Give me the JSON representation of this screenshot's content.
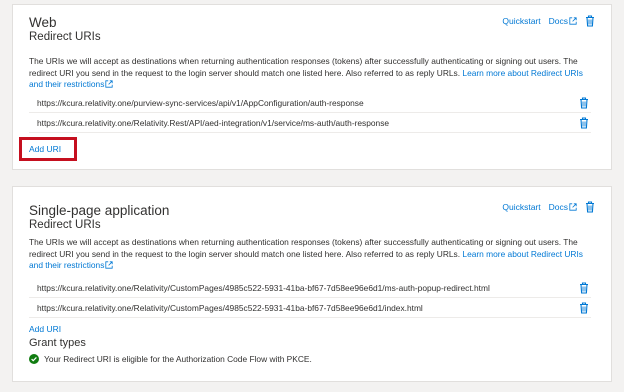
{
  "web": {
    "title": "Web",
    "subtitle": "Redirect URIs",
    "quickstart": "Quickstart",
    "docs": "Docs",
    "description_text": "The URIs we will accept as destinations when returning authentication responses (tokens) after successfully authenticating or signing out users. The redirect URI you send in the request to the login server should match one listed here. Also referred to as reply URLs.",
    "learn_more": "Learn more about Redirect URIs and their restrictions",
    "uris": [
      "https://kcura.relativity.one/purview-sync-services/api/v1/AppConfiguration/auth-response",
      "https://kcura.relativity.one/Relativity.Rest/API/aed-integration/v1/service/ms-auth/auth-response"
    ],
    "add_uri": "Add URI"
  },
  "spa": {
    "title": "Single-page application",
    "subtitle": "Redirect URIs",
    "quickstart": "Quickstart",
    "docs": "Docs",
    "description_text": "The URIs we will accept as destinations when returning authentication responses (tokens) after successfully authenticating or signing out users. The redirect URI you send in the request to the login server should match one listed here. Also referred to as reply URLs.",
    "learn_more": "Learn more about Redirect URIs and their restrictions",
    "uris": [
      "https://kcura.relativity.one/Relativity/CustomPages/4985c522-5931-41ba-bf67-7d58ee96e6d1/ms-auth-popup-redirect.html",
      "https://kcura.relativity.one/Relativity/CustomPages/4985c522-5931-41ba-bf67-7d58ee96e6d1/index.html"
    ],
    "add_uri": "Add URI",
    "grant_types_title": "Grant types",
    "grant_status": "Your Redirect URI is eligible for the Authorization Code Flow with PKCE."
  },
  "colors": {
    "link": "#0078d4",
    "highlight": "#c50f1f",
    "success": "#107c10"
  },
  "icons": {
    "delete": "trash-icon",
    "external": "external-link-icon",
    "success": "checkmark-circle-icon"
  }
}
